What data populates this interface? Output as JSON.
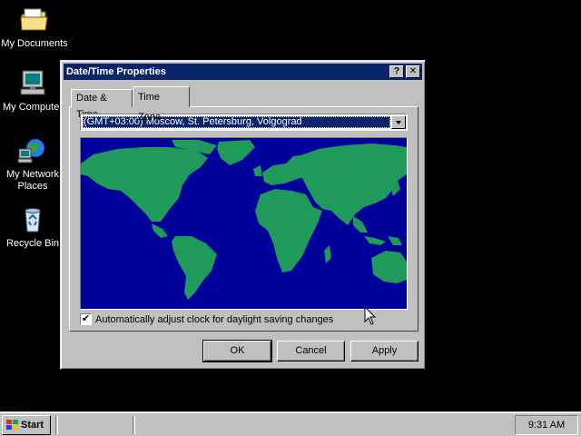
{
  "desktop": {
    "icons": [
      {
        "label": "My Documents",
        "icon": "folder-icon"
      },
      {
        "label": "My Computer",
        "icon": "computer-icon"
      },
      {
        "label": "My Network\nPlaces",
        "icon": "network-icon"
      },
      {
        "label": "Recycle Bin",
        "icon": "recycle-bin-icon"
      }
    ]
  },
  "dialog": {
    "title": "Date/Time Properties",
    "help_btn": "?",
    "close_btn": "✕",
    "tabs": [
      {
        "label": "Date & Time",
        "active": false
      },
      {
        "label": "Time Zone",
        "active": true
      }
    ],
    "timezone": {
      "selected": "(GMT+03:00) Moscow, St. Petersburg, Volgograd"
    },
    "map": {
      "ocean_color": "#00009a",
      "land_color": "#1f9a5a"
    },
    "daylight_checkbox": {
      "checked": true,
      "check_mark": "✔",
      "label": "Automatically adjust clock for daylight saving changes"
    },
    "buttons": {
      "ok": "OK",
      "cancel": "Cancel",
      "apply": "Apply"
    }
  },
  "taskbar": {
    "start_label": "Start",
    "clock": "9:31 AM"
  },
  "colors": {
    "titlebar": "#0a246a",
    "face": "#c0c0c0",
    "desktop": "#000000"
  }
}
